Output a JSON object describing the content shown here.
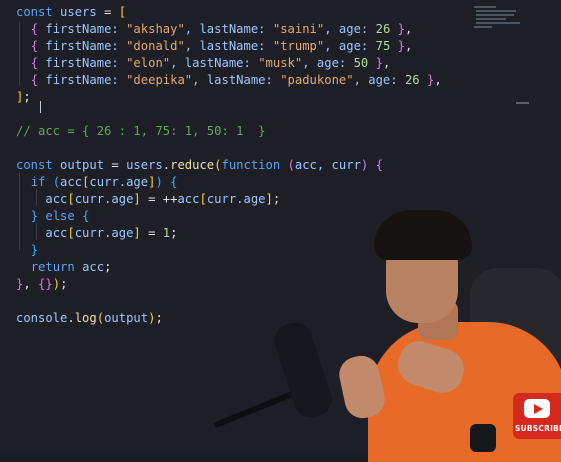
{
  "code_lines": [
    [
      {
        "t": "const ",
        "c": "kw"
      },
      {
        "t": "users",
        "c": "id"
      },
      {
        "t": " = ",
        "c": "pn"
      },
      {
        "t": "[",
        "c": "br1"
      }
    ],
    [
      {
        "t": "  ",
        "c": "pn"
      },
      {
        "t": "{",
        "c": "br2"
      },
      {
        "t": " firstName: ",
        "c": "id"
      },
      {
        "t": "\"akshay\"",
        "c": "str"
      },
      {
        "t": ", lastName: ",
        "c": "id"
      },
      {
        "t": "\"saini\"",
        "c": "str"
      },
      {
        "t": ", age: ",
        "c": "id"
      },
      {
        "t": "26",
        "c": "num"
      },
      {
        "t": " ",
        "c": "pn"
      },
      {
        "t": "}",
        "c": "br2"
      },
      {
        "t": ",",
        "c": "pn"
      }
    ],
    [
      {
        "t": "  ",
        "c": "pn"
      },
      {
        "t": "{",
        "c": "br2"
      },
      {
        "t": " firstName: ",
        "c": "id"
      },
      {
        "t": "\"donald\"",
        "c": "str"
      },
      {
        "t": ", lastName: ",
        "c": "id"
      },
      {
        "t": "\"trump\"",
        "c": "str"
      },
      {
        "t": ", age: ",
        "c": "id"
      },
      {
        "t": "75",
        "c": "num"
      },
      {
        "t": " ",
        "c": "pn"
      },
      {
        "t": "}",
        "c": "br2"
      },
      {
        "t": ",",
        "c": "pn"
      }
    ],
    [
      {
        "t": "  ",
        "c": "pn"
      },
      {
        "t": "{",
        "c": "br2"
      },
      {
        "t": " firstName: ",
        "c": "id"
      },
      {
        "t": "\"elon\"",
        "c": "str"
      },
      {
        "t": ", lastName: ",
        "c": "id"
      },
      {
        "t": "\"musk\"",
        "c": "str"
      },
      {
        "t": ", age: ",
        "c": "id"
      },
      {
        "t": "50",
        "c": "num"
      },
      {
        "t": " ",
        "c": "pn"
      },
      {
        "t": "}",
        "c": "br2"
      },
      {
        "t": ",",
        "c": "pn"
      }
    ],
    [
      {
        "t": "  ",
        "c": "pn"
      },
      {
        "t": "{",
        "c": "br2"
      },
      {
        "t": " firstName: ",
        "c": "id"
      },
      {
        "t": "\"deepika\"",
        "c": "str"
      },
      {
        "t": ", lastName: ",
        "c": "id"
      },
      {
        "t": "\"padukone\"",
        "c": "str"
      },
      {
        "t": ", age: ",
        "c": "id"
      },
      {
        "t": "26",
        "c": "num"
      },
      {
        "t": " ",
        "c": "pn"
      },
      {
        "t": "}",
        "c": "br2"
      },
      {
        "t": ",",
        "c": "pn"
      }
    ],
    [
      {
        "t": "]",
        "c": "br1"
      },
      {
        "t": ";",
        "c": "pn"
      }
    ],
    [],
    [
      {
        "t": "// acc = { 26 : 1, 75: 1, 50: 1  }",
        "c": "cm"
      }
    ],
    [],
    [
      {
        "t": "const ",
        "c": "kw"
      },
      {
        "t": "output",
        "c": "id"
      },
      {
        "t": " = ",
        "c": "pn"
      },
      {
        "t": "users",
        "c": "id"
      },
      {
        "t": ".",
        "c": "pn"
      },
      {
        "t": "reduce",
        "c": "fn"
      },
      {
        "t": "(",
        "c": "br1"
      },
      {
        "t": "function ",
        "c": "kw"
      },
      {
        "t": "(",
        "c": "br2"
      },
      {
        "t": "acc, curr",
        "c": "id"
      },
      {
        "t": ")",
        "c": "br2"
      },
      {
        "t": " ",
        "c": "pn"
      },
      {
        "t": "{",
        "c": "br2"
      }
    ],
    [
      {
        "t": "  ",
        "c": "pn"
      },
      {
        "t": "if ",
        "c": "kw"
      },
      {
        "t": "(",
        "c": "br3"
      },
      {
        "t": "acc",
        "c": "id"
      },
      {
        "t": "[",
        "c": "br1"
      },
      {
        "t": "curr.age",
        "c": "id"
      },
      {
        "t": "]",
        "c": "br1"
      },
      {
        "t": ")",
        "c": "br3"
      },
      {
        "t": " ",
        "c": "pn"
      },
      {
        "t": "{",
        "c": "br3"
      }
    ],
    [
      {
        "t": "    ",
        "c": "pn"
      },
      {
        "t": "acc",
        "c": "id"
      },
      {
        "t": "[",
        "c": "br1"
      },
      {
        "t": "curr.age",
        "c": "id"
      },
      {
        "t": "]",
        "c": "br1"
      },
      {
        "t": " = ++",
        "c": "pn"
      },
      {
        "t": "acc",
        "c": "id"
      },
      {
        "t": "[",
        "c": "br1"
      },
      {
        "t": "curr.age",
        "c": "id"
      },
      {
        "t": "]",
        "c": "br1"
      },
      {
        "t": ";",
        "c": "pn"
      }
    ],
    [
      {
        "t": "  ",
        "c": "pn"
      },
      {
        "t": "}",
        "c": "br3"
      },
      {
        "t": " ",
        "c": "pn"
      },
      {
        "t": "else ",
        "c": "kw"
      },
      {
        "t": "{",
        "c": "br3"
      }
    ],
    [
      {
        "t": "    ",
        "c": "pn"
      },
      {
        "t": "acc",
        "c": "id"
      },
      {
        "t": "[",
        "c": "br1"
      },
      {
        "t": "curr.age",
        "c": "id"
      },
      {
        "t": "]",
        "c": "br1"
      },
      {
        "t": " = ",
        "c": "pn"
      },
      {
        "t": "1",
        "c": "num"
      },
      {
        "t": ";",
        "c": "pn"
      }
    ],
    [
      {
        "t": "  ",
        "c": "pn"
      },
      {
        "t": "}",
        "c": "br3"
      }
    ],
    [
      {
        "t": "  ",
        "c": "pn"
      },
      {
        "t": "return ",
        "c": "kw"
      },
      {
        "t": "acc",
        "c": "id"
      },
      {
        "t": ";",
        "c": "pn"
      }
    ],
    [
      {
        "t": "}",
        "c": "br2"
      },
      {
        "t": ", ",
        "c": "pn"
      },
      {
        "t": "{}",
        "c": "br2"
      },
      {
        "t": ")",
        "c": "br1"
      },
      {
        "t": ";",
        "c": "pn"
      }
    ],
    [],
    [
      {
        "t": "console",
        "c": "id"
      },
      {
        "t": ".",
        "c": "pn"
      },
      {
        "t": "log",
        "c": "fn"
      },
      {
        "t": "(",
        "c": "br1"
      },
      {
        "t": "output",
        "c": "id"
      },
      {
        "t": ")",
        "c": "br1"
      },
      {
        "t": ";",
        "c": "pn"
      }
    ]
  ],
  "youtube": {
    "label": "SUBSCRIBE",
    "color": "#d5281f"
  },
  "colors": {
    "background": "#1e1f26",
    "accent": "#e86a28"
  }
}
